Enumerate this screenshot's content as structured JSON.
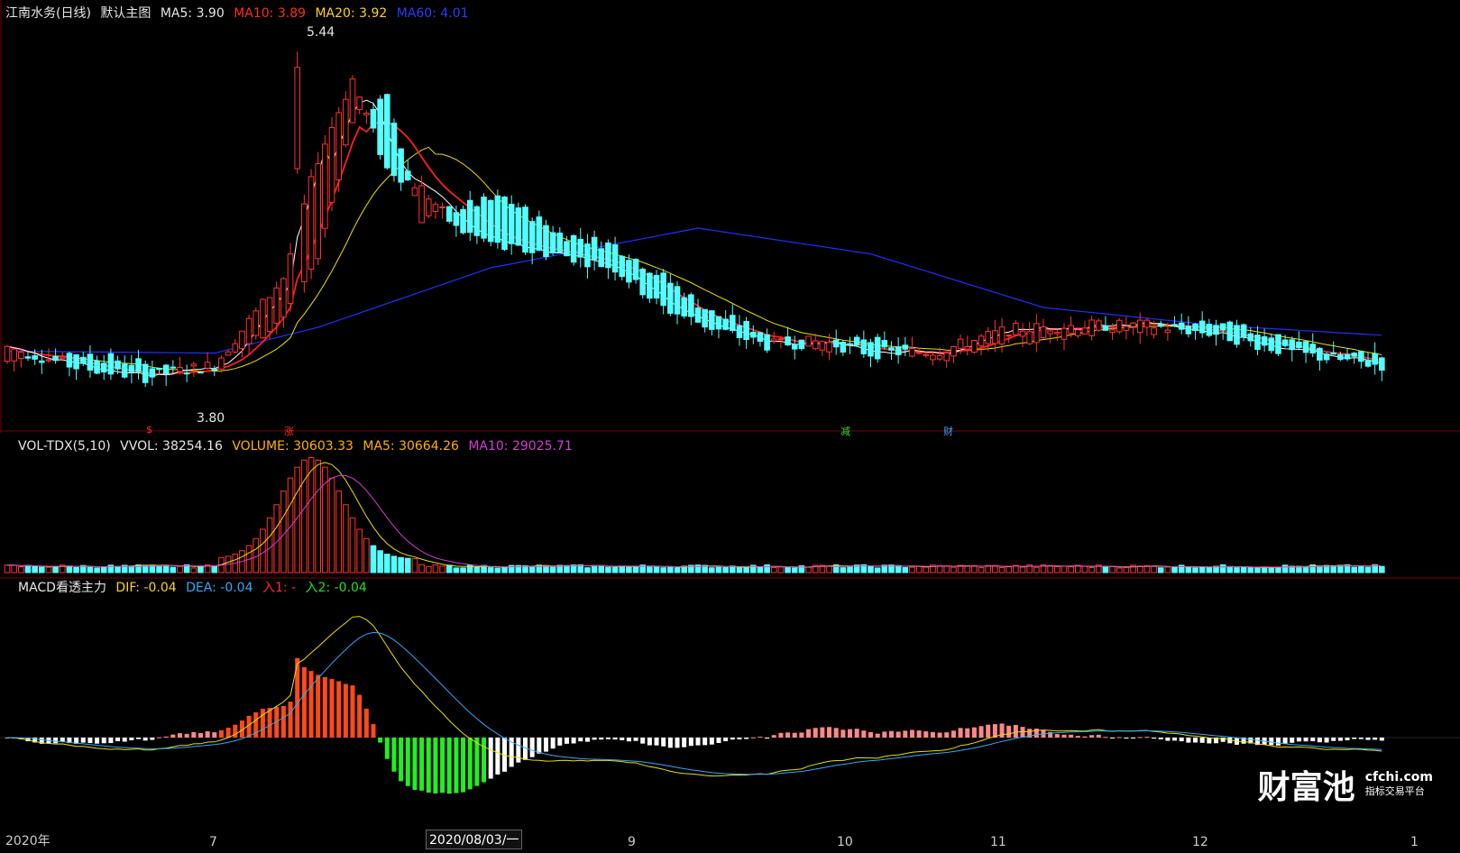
{
  "header_main": {
    "stock": "江南水务(日线)",
    "template": "默认主图",
    "ma5": "MA5: 3.90",
    "ma10": "MA10: 3.89",
    "ma20": "MA20: 3.92",
    "ma60": "MA60: 4.01",
    "high_label": "5.44",
    "low_label": "3.80"
  },
  "header_vol": {
    "name": "VOL-TDX(5,10)",
    "vvol": "VVOL: 38254.16",
    "volume": "VOLUME: 30603.33",
    "ma5": "MA5: 30664.26",
    "ma10": "MA10: 29025.71"
  },
  "header_macd": {
    "name": "MACD看透主力",
    "dif": "DIF: -0.04",
    "dea": "DEA: -0.04",
    "in1": "入1: -",
    "in2": "入2: -0.04"
  },
  "markers": [
    "$",
    "涨",
    "减",
    "财"
  ],
  "x_axis": {
    "start": "2020年",
    "labels": [
      "7",
      "9",
      "10",
      "11",
      "12",
      "1"
    ],
    "cursor_date": "2020/08/03/一"
  },
  "watermark": {
    "brand": "财富池",
    "site": "cfchi.com",
    "tagline": "指标交易平台"
  },
  "colors": {
    "up": "#ff3333",
    "down": "#54ffff",
    "ma5": "#ffffff",
    "ma10": "#ff1f1f",
    "ma20": "#e8e000",
    "ma60": "#1f2fff"
  },
  "chart_data": [
    {
      "type": "candlestick",
      "ylim": [
        3.6,
        5.6
      ],
      "high": 5.44,
      "low": 3.8,
      "ohlc_anchors": [
        [
          0,
          3.88,
          3.95
        ],
        [
          10,
          3.92,
          3.85
        ],
        [
          20,
          3.86,
          3.8
        ],
        [
          30,
          3.84,
          3.86
        ],
        [
          40,
          4.1,
          4.3
        ],
        [
          45,
          4.4,
          4.9
        ],
        [
          50,
          5.1,
          5.3
        ],
        [
          55,
          5.2,
          4.85
        ],
        [
          60,
          4.6,
          4.75
        ],
        [
          65,
          4.65,
          4.55
        ],
        [
          72,
          4.7,
          4.45
        ],
        [
          80,
          4.52,
          4.42
        ],
        [
          88,
          4.46,
          4.35
        ],
        [
          95,
          4.3,
          4.15
        ],
        [
          102,
          4.12,
          4.05
        ],
        [
          110,
          4.02,
          3.96
        ],
        [
          118,
          3.95,
          3.98
        ],
        [
          125,
          3.98,
          3.92
        ],
        [
          135,
          3.9,
          3.93
        ],
        [
          145,
          3.98,
          4.04
        ],
        [
          155,
          4.02,
          4.06
        ],
        [
          165,
          4.04,
          4.06
        ],
        [
          175,
          4.06,
          4.02
        ],
        [
          185,
          4.0,
          3.93
        ],
        [
          192,
          3.92,
          3.89
        ],
        [
          199,
          3.9,
          3.86
        ]
      ],
      "ma60_anchors": [
        [
          0,
          3.93
        ],
        [
          30,
          3.92
        ],
        [
          45,
          4.05
        ],
        [
          70,
          4.35
        ],
        [
          100,
          4.55
        ],
        [
          125,
          4.42
        ],
        [
          150,
          4.15
        ],
        [
          175,
          4.06
        ],
        [
          199,
          4.01
        ]
      ]
    },
    {
      "type": "bar",
      "series": [
        "VOLUME",
        "MA5",
        "MA10"
      ],
      "peak_volume_index": 46
    },
    {
      "type": "bar",
      "series": [
        "DIF",
        "DEA",
        "MACD"
      ],
      "dif": -0.04,
      "dea": -0.04
    }
  ]
}
